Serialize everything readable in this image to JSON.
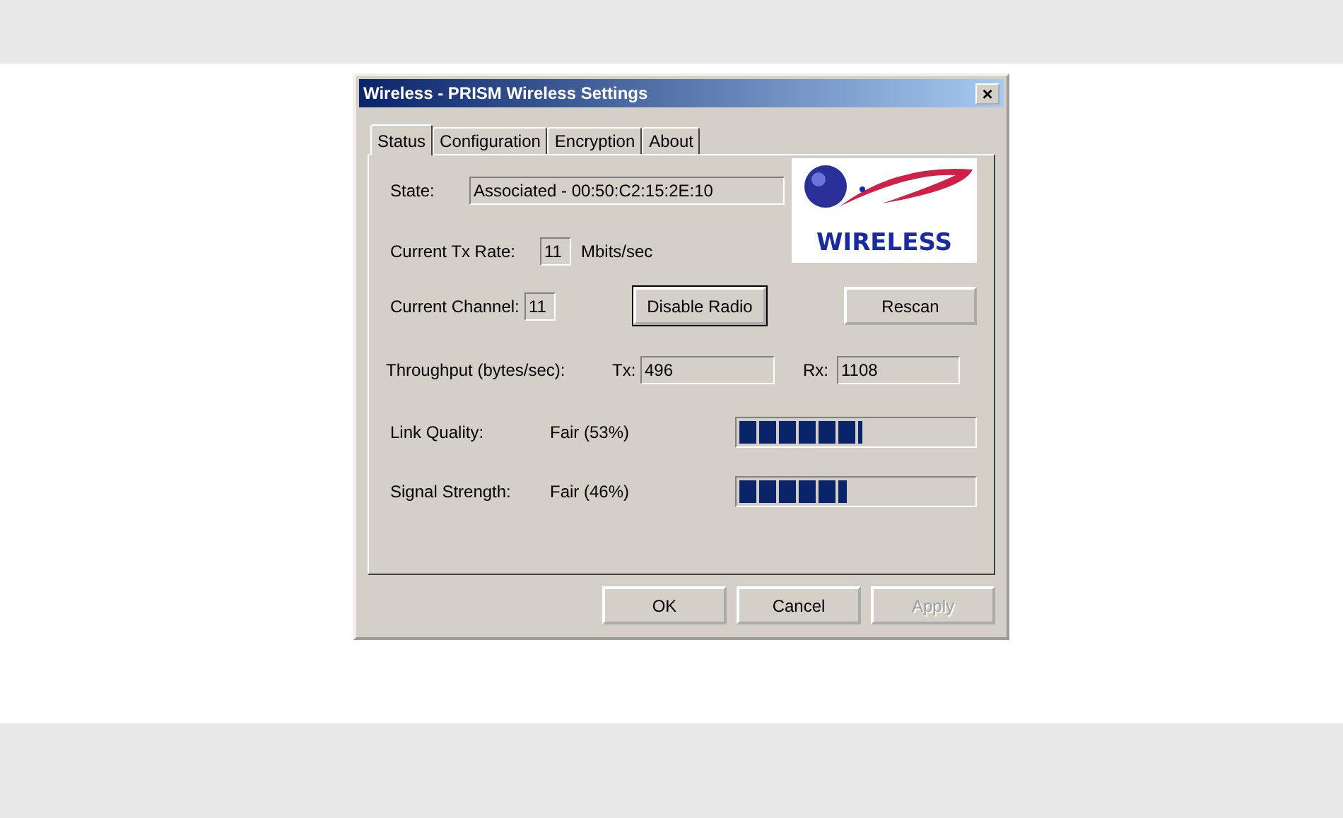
{
  "window": {
    "title": "Wireless - PRISM Wireless Settings",
    "close": "×"
  },
  "tabs": [
    {
      "label": "Status",
      "selected": true
    },
    {
      "label": "Configuration",
      "selected": false
    },
    {
      "label": "Encryption",
      "selected": false
    },
    {
      "label": "About",
      "selected": false
    }
  ],
  "logo": {
    "text": "WIRELESS"
  },
  "state": {
    "label": "State:",
    "value": "Associated - 00:50:C2:15:2E:10"
  },
  "tx_rate": {
    "label": "Current Tx Rate:",
    "value": "11",
    "unit": "Mbits/sec"
  },
  "channel": {
    "label": "Current Channel:",
    "value": "11"
  },
  "radio_buttons": [
    {
      "label": "Disable Radio",
      "default": true
    },
    {
      "label": "Rescan",
      "default": false
    }
  ],
  "throughput": {
    "label": "Throughput (bytes/sec):",
    "tx_label": "Tx:",
    "tx": "496",
    "rx_label": "Rx:",
    "rx": "1108"
  },
  "meters": [
    {
      "label": "Link Quality:",
      "reading": "Fair (53%)",
      "level": 0.53
    },
    {
      "label": "Signal Strength:",
      "reading": "Fair (46%)",
      "level": 0.46
    }
  ],
  "buttons": [
    {
      "label": "OK",
      "disabled": false
    },
    {
      "label": "Cancel",
      "disabled": false
    },
    {
      "label": "Apply",
      "disabled": true
    }
  ]
}
